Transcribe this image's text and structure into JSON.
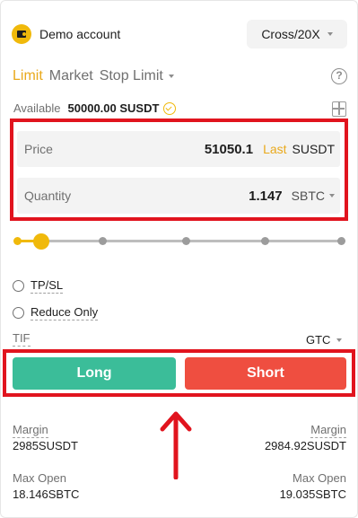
{
  "header": {
    "account_label": "Demo account",
    "margin_mode": "Cross/20X"
  },
  "tabs": [
    {
      "label": "Limit",
      "active": true
    },
    {
      "label": "Market",
      "active": false
    },
    {
      "label": "Stop Limit",
      "active": false
    }
  ],
  "help_glyph": "?",
  "available": {
    "label": "Available",
    "value": "50000.00 SUSDT"
  },
  "price": {
    "label": "Price",
    "value": "51050.1",
    "link": "Last",
    "unit": "SUSDT"
  },
  "quantity": {
    "label": "Quantity",
    "value": "1.147",
    "unit": "SBTC"
  },
  "leverage_slider": {
    "fraction": 0.08
  },
  "options": {
    "tpsl": "TP/SL",
    "reduce_only": "Reduce Only",
    "tif_label": "TIF",
    "tif_value": "GTC"
  },
  "actions": {
    "long": "Long",
    "short": "Short"
  },
  "stats": {
    "long_margin_label": "Margin",
    "long_margin_value": "2985SUSDT",
    "short_margin_label": "Margin",
    "short_margin_value": "2984.92SUSDT",
    "long_max_label": "Max Open",
    "long_max_value": "18.146SBTC",
    "short_max_label": "Max Open",
    "short_max_value": "19.035SBTC"
  },
  "colors": {
    "accent": "#f0b90b",
    "long": "#3bbd99",
    "short": "#ef4e40",
    "highlight": "#e1141e"
  },
  "icons": [
    "wallet-icon",
    "chevron-down-icon",
    "help-icon",
    "coin-icon",
    "calculator-icon",
    "arrow-up-icon"
  ]
}
